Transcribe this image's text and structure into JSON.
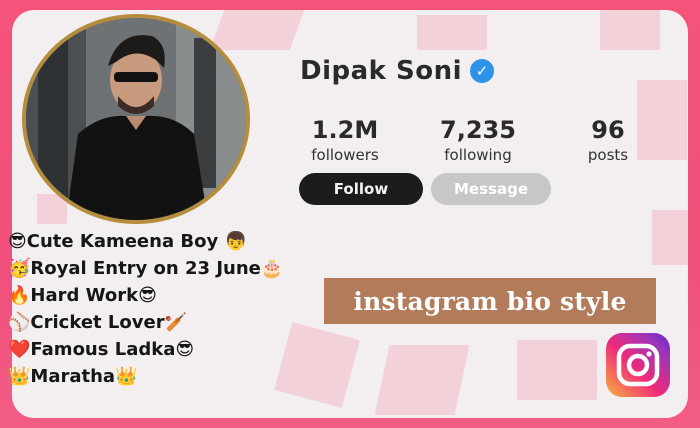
{
  "profile": {
    "name": "Dipak Soni",
    "verified_icon": "verified-badge-icon",
    "stats": [
      {
        "value": "1.2M",
        "label": "followers"
      },
      {
        "value": "7,235",
        "label": "following"
      },
      {
        "value": "96",
        "label": "posts"
      }
    ],
    "follow_label": "Follow",
    "message_label": "Message"
  },
  "bio": {
    "lines": [
      {
        "emoji": "😎",
        "text": "Cute Kameena Boy",
        "trail": "👦"
      },
      {
        "emoji": "🥳",
        "text": "Royal Entry on 23 June",
        "trail": "🎂"
      },
      {
        "emoji": "🔥",
        "text": "Hard Work",
        "trail": "😎"
      },
      {
        "emoji": "⚾",
        "text": "Cricket Lover",
        "trail": "🏏"
      },
      {
        "emoji": "❤️",
        "text": "Famous Ladka",
        "trail": "😎"
      },
      {
        "emoji": "👑",
        "text": "Maratha",
        "trail": "👑"
      }
    ]
  },
  "overlay": {
    "style_label": "instagram bio style"
  },
  "icons": {
    "logo": "instagram-logo-icon"
  },
  "colors": {
    "accent_border": "#f5537a",
    "verify_blue": "#2d93e8",
    "follow_bg": "#1c1c1c",
    "label_bg": "#b27c5b"
  }
}
